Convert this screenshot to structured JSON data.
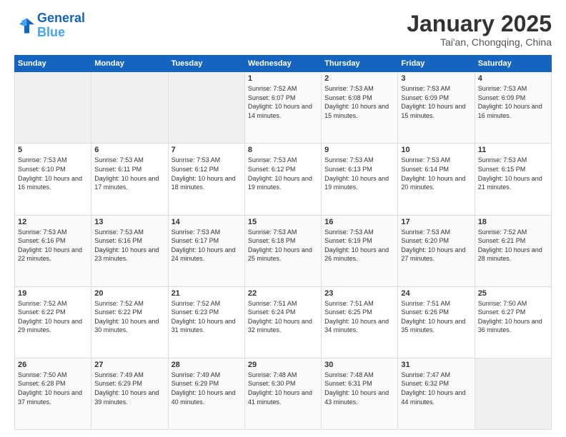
{
  "header": {
    "logo_line1": "General",
    "logo_line2": "Blue",
    "title": "January 2025",
    "subtitle": "Tai'an, Chongqing, China"
  },
  "weekdays": [
    "Sunday",
    "Monday",
    "Tuesday",
    "Wednesday",
    "Thursday",
    "Friday",
    "Saturday"
  ],
  "rows": [
    [
      {
        "day": "",
        "sunrise": "",
        "sunset": "",
        "daylight": "",
        "empty": true
      },
      {
        "day": "",
        "sunrise": "",
        "sunset": "",
        "daylight": "",
        "empty": true
      },
      {
        "day": "",
        "sunrise": "",
        "sunset": "",
        "daylight": "",
        "empty": true
      },
      {
        "day": "1",
        "sunrise": "7:52 AM",
        "sunset": "6:07 PM",
        "daylight": "10 hours and 14 minutes."
      },
      {
        "day": "2",
        "sunrise": "7:53 AM",
        "sunset": "6:08 PM",
        "daylight": "10 hours and 15 minutes."
      },
      {
        "day": "3",
        "sunrise": "7:53 AM",
        "sunset": "6:09 PM",
        "daylight": "10 hours and 15 minutes."
      },
      {
        "day": "4",
        "sunrise": "7:53 AM",
        "sunset": "6:09 PM",
        "daylight": "10 hours and 16 minutes."
      }
    ],
    [
      {
        "day": "5",
        "sunrise": "7:53 AM",
        "sunset": "6:10 PM",
        "daylight": "10 hours and 16 minutes."
      },
      {
        "day": "6",
        "sunrise": "7:53 AM",
        "sunset": "6:11 PM",
        "daylight": "10 hours and 17 minutes."
      },
      {
        "day": "7",
        "sunrise": "7:53 AM",
        "sunset": "6:12 PM",
        "daylight": "10 hours and 18 minutes."
      },
      {
        "day": "8",
        "sunrise": "7:53 AM",
        "sunset": "6:12 PM",
        "daylight": "10 hours and 19 minutes."
      },
      {
        "day": "9",
        "sunrise": "7:53 AM",
        "sunset": "6:13 PM",
        "daylight": "10 hours and 19 minutes."
      },
      {
        "day": "10",
        "sunrise": "7:53 AM",
        "sunset": "6:14 PM",
        "daylight": "10 hours and 20 minutes."
      },
      {
        "day": "11",
        "sunrise": "7:53 AM",
        "sunset": "6:15 PM",
        "daylight": "10 hours and 21 minutes."
      }
    ],
    [
      {
        "day": "12",
        "sunrise": "7:53 AM",
        "sunset": "6:16 PM",
        "daylight": "10 hours and 22 minutes."
      },
      {
        "day": "13",
        "sunrise": "7:53 AM",
        "sunset": "6:16 PM",
        "daylight": "10 hours and 23 minutes."
      },
      {
        "day": "14",
        "sunrise": "7:53 AM",
        "sunset": "6:17 PM",
        "daylight": "10 hours and 24 minutes."
      },
      {
        "day": "15",
        "sunrise": "7:53 AM",
        "sunset": "6:18 PM",
        "daylight": "10 hours and 25 minutes."
      },
      {
        "day": "16",
        "sunrise": "7:53 AM",
        "sunset": "6:19 PM",
        "daylight": "10 hours and 26 minutes."
      },
      {
        "day": "17",
        "sunrise": "7:53 AM",
        "sunset": "6:20 PM",
        "daylight": "10 hours and 27 minutes."
      },
      {
        "day": "18",
        "sunrise": "7:52 AM",
        "sunset": "6:21 PM",
        "daylight": "10 hours and 28 minutes."
      }
    ],
    [
      {
        "day": "19",
        "sunrise": "7:52 AM",
        "sunset": "6:22 PM",
        "daylight": "10 hours and 29 minutes."
      },
      {
        "day": "20",
        "sunrise": "7:52 AM",
        "sunset": "6:22 PM",
        "daylight": "10 hours and 30 minutes."
      },
      {
        "day": "21",
        "sunrise": "7:52 AM",
        "sunset": "6:23 PM",
        "daylight": "10 hours and 31 minutes."
      },
      {
        "day": "22",
        "sunrise": "7:51 AM",
        "sunset": "6:24 PM",
        "daylight": "10 hours and 32 minutes."
      },
      {
        "day": "23",
        "sunrise": "7:51 AM",
        "sunset": "6:25 PM",
        "daylight": "10 hours and 34 minutes."
      },
      {
        "day": "24",
        "sunrise": "7:51 AM",
        "sunset": "6:26 PM",
        "daylight": "10 hours and 35 minutes."
      },
      {
        "day": "25",
        "sunrise": "7:50 AM",
        "sunset": "6:27 PM",
        "daylight": "10 hours and 36 minutes."
      }
    ],
    [
      {
        "day": "26",
        "sunrise": "7:50 AM",
        "sunset": "6:28 PM",
        "daylight": "10 hours and 37 minutes."
      },
      {
        "day": "27",
        "sunrise": "7:49 AM",
        "sunset": "6:29 PM",
        "daylight": "10 hours and 39 minutes."
      },
      {
        "day": "28",
        "sunrise": "7:49 AM",
        "sunset": "6:29 PM",
        "daylight": "10 hours and 40 minutes."
      },
      {
        "day": "29",
        "sunrise": "7:48 AM",
        "sunset": "6:30 PM",
        "daylight": "10 hours and 41 minutes."
      },
      {
        "day": "30",
        "sunrise": "7:48 AM",
        "sunset": "6:31 PM",
        "daylight": "10 hours and 43 minutes."
      },
      {
        "day": "31",
        "sunrise": "7:47 AM",
        "sunset": "6:32 PM",
        "daylight": "10 hours and 44 minutes."
      },
      {
        "day": "",
        "sunrise": "",
        "sunset": "",
        "daylight": "",
        "empty": true
      }
    ]
  ]
}
